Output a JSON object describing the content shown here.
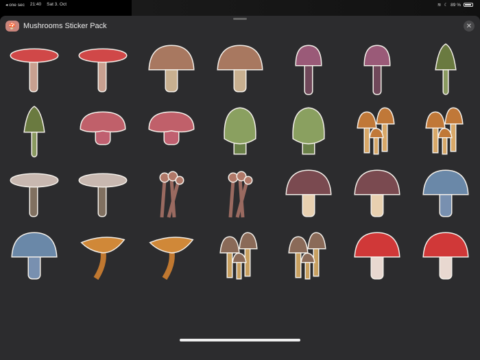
{
  "status_bar": {
    "back_app": "◂ one sec",
    "time": "21:40",
    "date": "Sat 3. Oct",
    "battery": "89 %",
    "battery_level": 0.89
  },
  "sheet": {
    "title": "Mushrooms Sticker Pack",
    "close_icon": "close-icon"
  },
  "stickers": [
    {
      "shape": "flat",
      "cap": "#d04848",
      "stem": "#c8a090"
    },
    {
      "shape": "flat",
      "cap": "#d04848",
      "stem": "#c8a090"
    },
    {
      "shape": "dome",
      "cap": "#a87860",
      "stem": "#c8b090"
    },
    {
      "shape": "dome",
      "cap": "#a87860",
      "stem": "#c8b090"
    },
    {
      "shape": "bell",
      "cap": "#9a5a78",
      "stem": "#70485a"
    },
    {
      "shape": "bell",
      "cap": "#9a5a78",
      "stem": "#70485a"
    },
    {
      "shape": "conical",
      "cap": "#6a7a40",
      "stem": "#8a9a60"
    },
    {
      "shape": "conical",
      "cap": "#6a7a40",
      "stem": "#8a9a60"
    },
    {
      "shape": "lumpy",
      "cap": "#c0606a",
      "stem": "#c06070"
    },
    {
      "shape": "lumpy",
      "cap": "#c0606a",
      "stem": "#c06070"
    },
    {
      "shape": "egg",
      "cap": "#8aa060",
      "stem": "#6a8048"
    },
    {
      "shape": "egg",
      "cap": "#8aa060",
      "stem": "#6a8048"
    },
    {
      "shape": "cluster",
      "cap": "#c07838",
      "stem": "#d8a868"
    },
    {
      "shape": "cluster",
      "cap": "#c07838",
      "stem": "#d8a868"
    },
    {
      "shape": "flat",
      "cap": "#c8b8b0",
      "stem": "#807060"
    },
    {
      "shape": "flat",
      "cap": "#c8b8b0",
      "stem": "#807060"
    },
    {
      "shape": "stalks",
      "cap": "#b07868",
      "stem": "#9a6a60"
    },
    {
      "shape": "stalks",
      "cap": "#b07868",
      "stem": "#9a6a60"
    },
    {
      "shape": "dome",
      "cap": "#7a4a50",
      "stem": "#e8d0b0"
    },
    {
      "shape": "dome",
      "cap": "#7a4a50",
      "stem": "#e8d0b0"
    },
    {
      "shape": "dome",
      "cap": "#6a88a8",
      "stem": "#7890b0"
    },
    {
      "shape": "dome",
      "cap": "#6a88a8",
      "stem": "#7890b0"
    },
    {
      "shape": "funnel",
      "cap": "#d08838",
      "stem": "#c07830"
    },
    {
      "shape": "funnel",
      "cap": "#d08838",
      "stem": "#c07830"
    },
    {
      "shape": "cluster",
      "cap": "#8a6a58",
      "stem": "#c8a060"
    },
    {
      "shape": "cluster",
      "cap": "#8a6a58",
      "stem": "#c8a060"
    },
    {
      "shape": "dome",
      "cap": "#d03838",
      "stem": "#e8d8d0"
    },
    {
      "shape": "dome",
      "cap": "#d03838",
      "stem": "#e8d8d0"
    }
  ]
}
